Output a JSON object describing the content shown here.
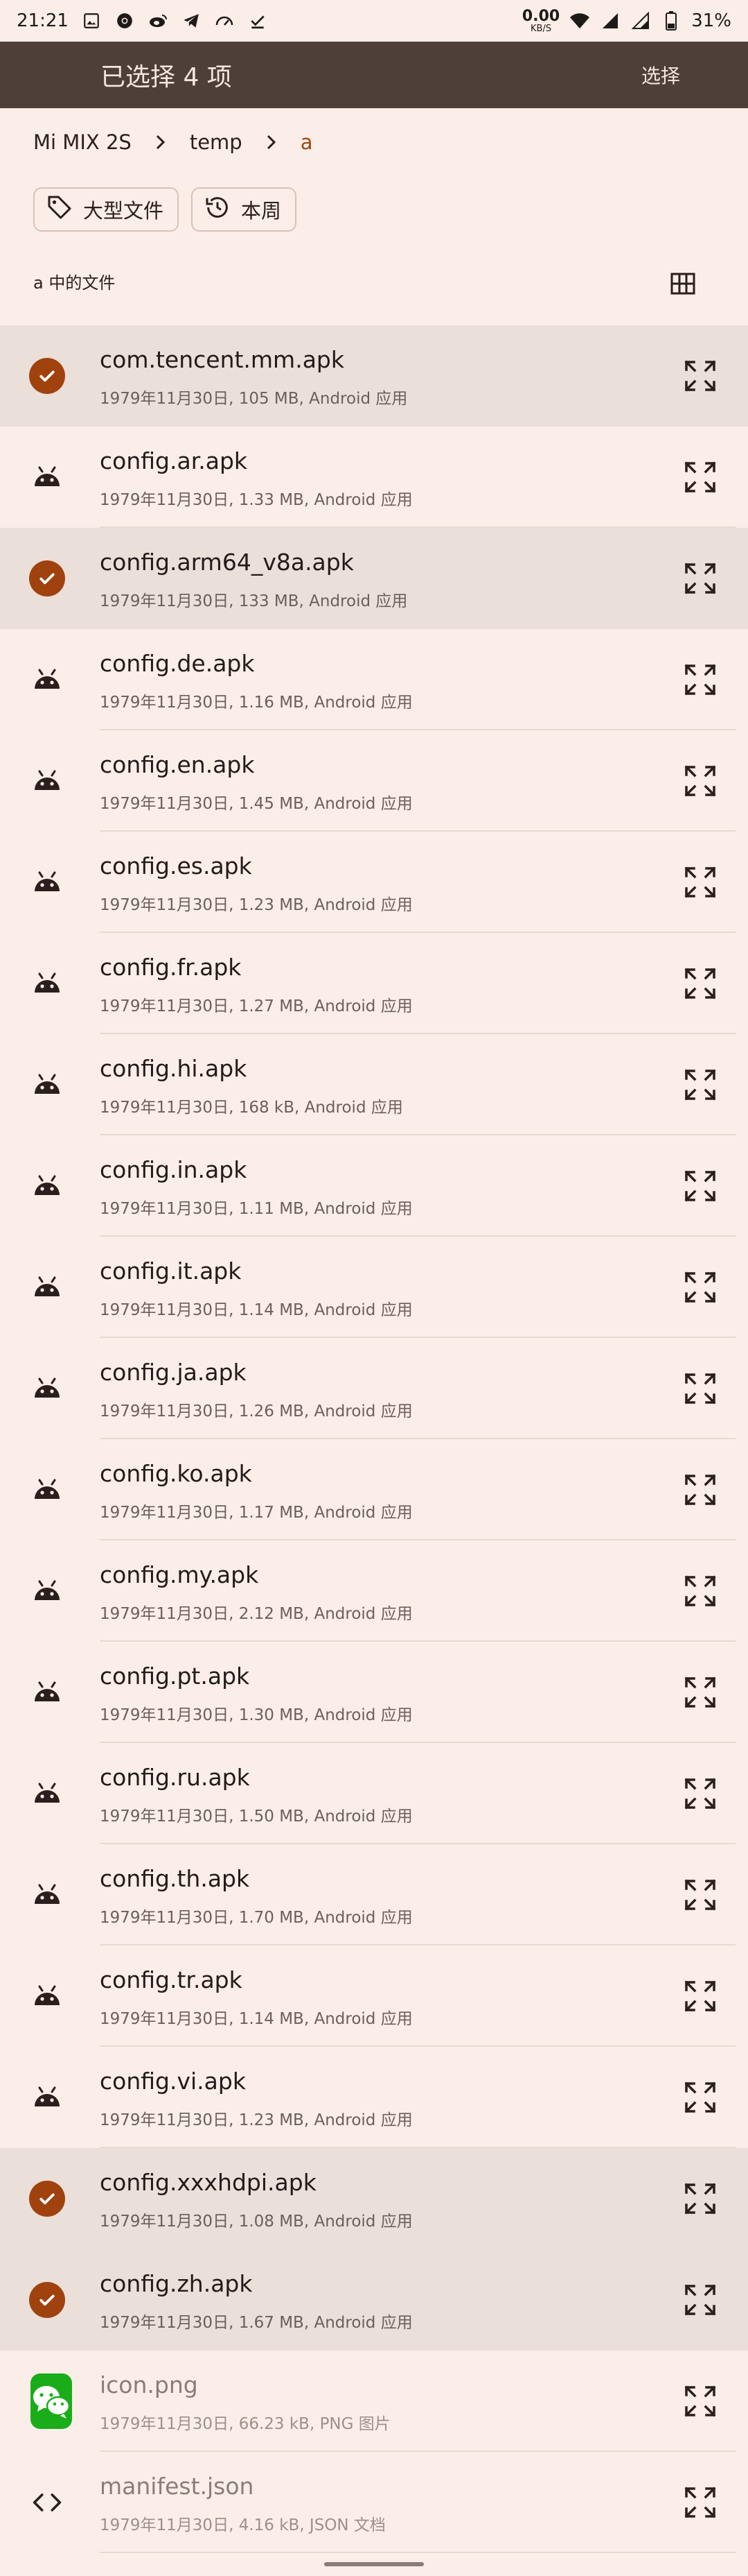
{
  "status_bar": {
    "time": "21:21",
    "net_speed_value": "0.00",
    "net_speed_unit": "KB/S",
    "battery": "31%",
    "icons": [
      "gallery-icon",
      "chrome-icon",
      "weibo-icon",
      "telegram-icon",
      "speedometer-icon",
      "checkmark-icon",
      "wifi-icon",
      "signal-icon",
      "signal-icon",
      "battery-icon"
    ]
  },
  "app_bar": {
    "title": "已选择 4 项",
    "action": "选择"
  },
  "breadcrumb": {
    "items": [
      "Mi MIX 2S",
      "temp",
      "a"
    ]
  },
  "filters": {
    "chips": [
      {
        "label": "大型文件",
        "icon": "tag-icon"
      },
      {
        "label": "本周",
        "icon": "history-icon"
      }
    ]
  },
  "section": {
    "header": "a 中的文件"
  },
  "colors": {
    "background": "#FBEEE8",
    "app_bar": "#4E3F38",
    "selected_row": "#EBDFDA",
    "accent": "#A0420E"
  },
  "files": [
    {
      "name": "com.tencent.mm.apk",
      "meta": "1979年11月30日, 105 MB, Android 应用",
      "selected": true,
      "icon": "android-icon"
    },
    {
      "name": "config.ar.apk",
      "meta": "1979年11月30日, 1.33 MB, Android 应用",
      "selected": false,
      "icon": "android-icon"
    },
    {
      "name": "config.arm64_v8a.apk",
      "meta": "1979年11月30日, 133 MB, Android 应用",
      "selected": true,
      "icon": "android-icon"
    },
    {
      "name": "config.de.apk",
      "meta": "1979年11月30日, 1.16 MB, Android 应用",
      "selected": false,
      "icon": "android-icon"
    },
    {
      "name": "config.en.apk",
      "meta": "1979年11月30日, 1.45 MB, Android 应用",
      "selected": false,
      "icon": "android-icon"
    },
    {
      "name": "config.es.apk",
      "meta": "1979年11月30日, 1.23 MB, Android 应用",
      "selected": false,
      "icon": "android-icon"
    },
    {
      "name": "config.fr.apk",
      "meta": "1979年11月30日, 1.27 MB, Android 应用",
      "selected": false,
      "icon": "android-icon"
    },
    {
      "name": "config.hi.apk",
      "meta": "1979年11月30日, 168 kB, Android 应用",
      "selected": false,
      "icon": "android-icon"
    },
    {
      "name": "config.in.apk",
      "meta": "1979年11月30日, 1.11 MB, Android 应用",
      "selected": false,
      "icon": "android-icon"
    },
    {
      "name": "config.it.apk",
      "meta": "1979年11月30日, 1.14 MB, Android 应用",
      "selected": false,
      "icon": "android-icon"
    },
    {
      "name": "config.ja.apk",
      "meta": "1979年11月30日, 1.26 MB, Android 应用",
      "selected": false,
      "icon": "android-icon"
    },
    {
      "name": "config.ko.apk",
      "meta": "1979年11月30日, 1.17 MB, Android 应用",
      "selected": false,
      "icon": "android-icon"
    },
    {
      "name": "config.my.apk",
      "meta": "1979年11月30日, 2.12 MB, Android 应用",
      "selected": false,
      "icon": "android-icon"
    },
    {
      "name": "config.pt.apk",
      "meta": "1979年11月30日, 1.30 MB, Android 应用",
      "selected": false,
      "icon": "android-icon"
    },
    {
      "name": "config.ru.apk",
      "meta": "1979年11月30日, 1.50 MB, Android 应用",
      "selected": false,
      "icon": "android-icon"
    },
    {
      "name": "config.th.apk",
      "meta": "1979年11月30日, 1.70 MB, Android 应用",
      "selected": false,
      "icon": "android-icon"
    },
    {
      "name": "config.tr.apk",
      "meta": "1979年11月30日, 1.14 MB, Android 应用",
      "selected": false,
      "icon": "android-icon"
    },
    {
      "name": "config.vi.apk",
      "meta": "1979年11月30日, 1.23 MB, Android 应用",
      "selected": false,
      "icon": "android-icon"
    },
    {
      "name": "config.xxxhdpi.apk",
      "meta": "1979年11月30日, 1.08 MB, Android 应用",
      "selected": true,
      "icon": "android-icon"
    },
    {
      "name": "config.zh.apk",
      "meta": "1979年11月30日, 1.67 MB, Android 应用",
      "selected": true,
      "icon": "android-icon"
    },
    {
      "name": "icon.png",
      "meta": "1979年11月30日, 66.23 kB, PNG 图片",
      "selected": false,
      "icon": "wechat-icon",
      "dim": true
    },
    {
      "name": "manifest.json",
      "meta": "1979年11月30日, 4.16 kB, JSON 文档",
      "selected": false,
      "icon": "code-icon",
      "dim": true
    }
  ]
}
